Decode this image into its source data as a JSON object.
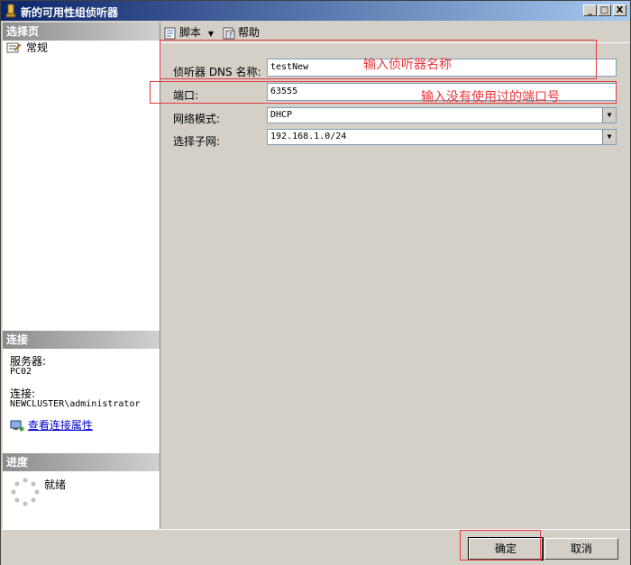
{
  "window": {
    "title": "新的可用性组侦听器",
    "controls": {
      "minimize": "_",
      "maximize": "□",
      "close": "X"
    }
  },
  "left": {
    "select_page_header": "选择页",
    "pages": [
      {
        "label": "常规",
        "icon": "properties-icon"
      }
    ],
    "connection_header": "连接",
    "server_label": "服务器:",
    "server_value": "PC02",
    "connection_label": "连接:",
    "connection_value": "NEWCLUSTER\\administrator",
    "view_connection_properties": "查看连接属性",
    "progress_header": "进度",
    "progress_status": "就绪"
  },
  "toolbar": {
    "script_label": "脚本",
    "help_label": "帮助"
  },
  "form": {
    "dns_name_label": "侦听器 DNS 名称:",
    "dns_name_value": "testNew",
    "port_label": "端口:",
    "port_value": "63555",
    "network_mode_label": "网络模式:",
    "network_mode_value": "DHCP",
    "subnet_label": "选择子网:",
    "subnet_value": "192.168.1.0/24"
  },
  "annotations": {
    "dns_hint": "输入侦听器名称",
    "port_hint": "输入没有使用过的端口号"
  },
  "buttons": {
    "ok": "确定",
    "cancel": "取消"
  },
  "colors": {
    "annotation": "#e8373d",
    "title_gradient_start": "#0a246a",
    "title_gradient_end": "#a6caf0"
  }
}
